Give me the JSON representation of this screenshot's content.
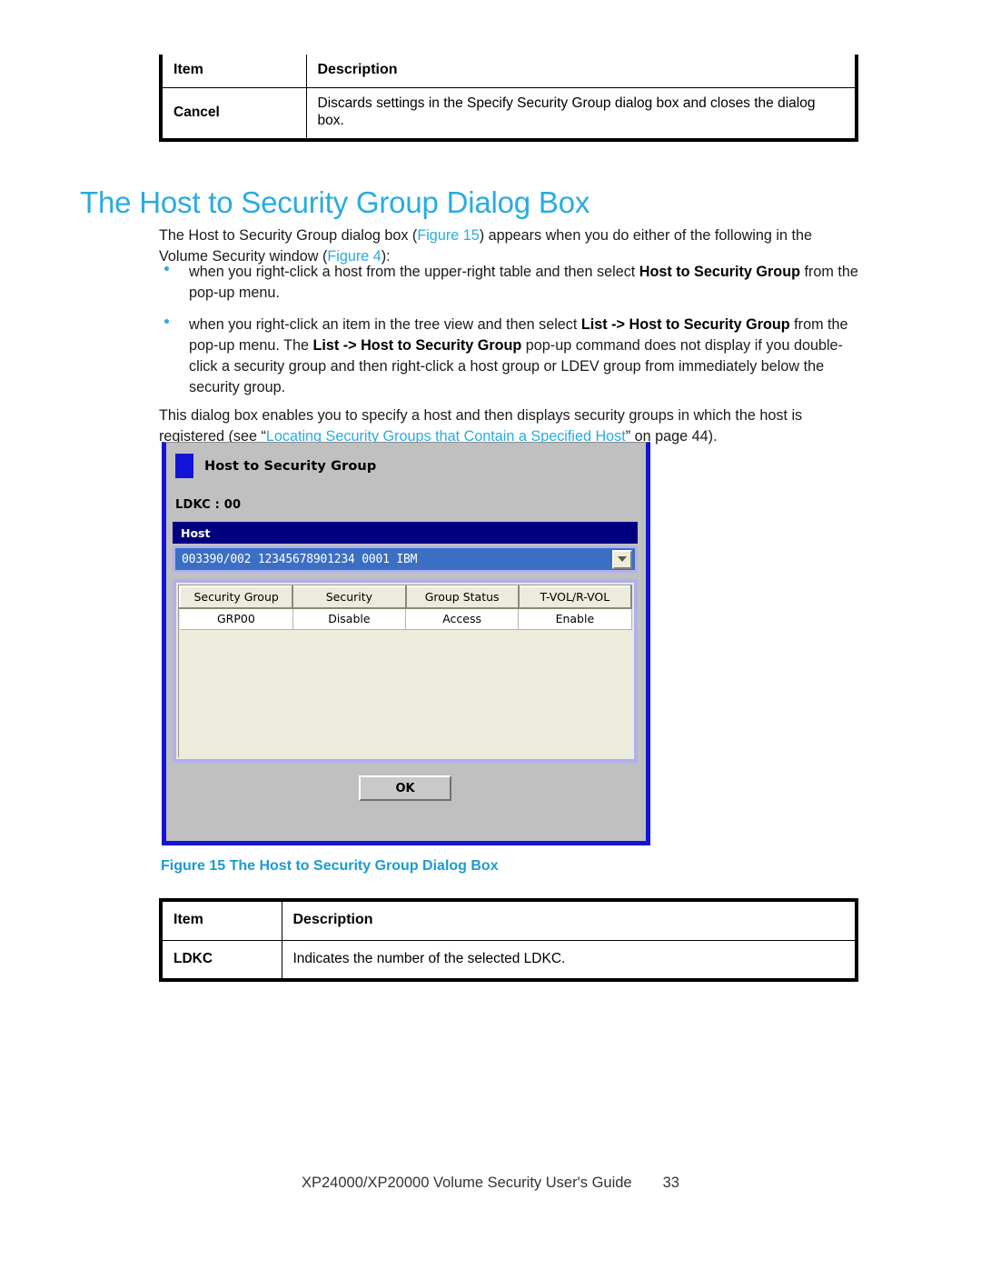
{
  "colors": {
    "heading": "#29ABE2",
    "caption": "#1B9BD1",
    "xref": "#29ABE2",
    "bullet": "#29ABE2",
    "dialog_border": "#1414D8",
    "dialog_face": "#C0C0C0",
    "header_bar": "#000080",
    "combo_fill": "#3A6FC4",
    "panel_fill": "#ECEBDC"
  },
  "table_top": {
    "headers": [
      "Item",
      "Description"
    ],
    "rows": [
      [
        "Cancel",
        "Discards settings in the Specify Security Group dialog box and closes the dialog box."
      ]
    ]
  },
  "heading": "The Host to Security Group Dialog Box",
  "intro": {
    "part1": "The Host to Security Group dialog box (",
    "xref1": "Figure",
    "xref1_num": "15",
    "part2": ") appears when you do either of the following in the Volume Security window (",
    "xref2": "Figure",
    "xref2_num": "4",
    "part3": "):"
  },
  "bullets": [
    {
      "segments": [
        {
          "text": "when you right-click a host from the upper-right table and then select ",
          "style": "normal"
        },
        {
          "text": "Host to Security Group",
          "style": "bold"
        },
        {
          "text": " from the pop-up menu.",
          "style": "normal"
        }
      ]
    },
    {
      "segments": [
        {
          "text": "when you right-click an item in the tree view and then select ",
          "style": "normal"
        },
        {
          "text": "List -> Host to Security Group",
          "style": "bold"
        },
        {
          "text": " from the pop-up menu. The ",
          "style": "normal"
        },
        {
          "text": "List -> Host to Security Group",
          "style": "bold"
        },
        {
          "text": " pop-up command does not display if you double-click a security group and then right-click a host group or LDEV group from immediately below the security group.",
          "style": "normal"
        }
      ]
    }
  ],
  "registered_para": {
    "part1": "This dialog box enables you to specify a host and then displays security groups in which the host is registered (see “",
    "xref": "Locating Security Groups that Contain a Specified Host",
    "part2": "” on page 44)."
  },
  "dialog": {
    "title": "Host to Security Group",
    "ldkc_label": "LDKC : 00",
    "host_header": "Host",
    "host_value": "003390/002  12345678901234  0001  IBM",
    "combo_arrow": "chevron-down-icon",
    "security_table": {
      "headers": [
        "Security Group",
        "Security",
        "Group Status",
        "T-VOL/R-VOL"
      ],
      "rows": [
        [
          "GRP00",
          "Disable",
          "Access",
          "Enable"
        ]
      ]
    },
    "ok_label": "OK"
  },
  "figure_caption": "Figure 15 The Host to Security Group Dialog Box",
  "table_bottom": {
    "headers": [
      "Item",
      "Description"
    ],
    "rows": [
      [
        "LDKC",
        "Indicates the number of the selected LDKC."
      ]
    ]
  },
  "footer": {
    "title": "XP24000/XP20000 Volume Security User's Guide",
    "page_number": "33"
  }
}
